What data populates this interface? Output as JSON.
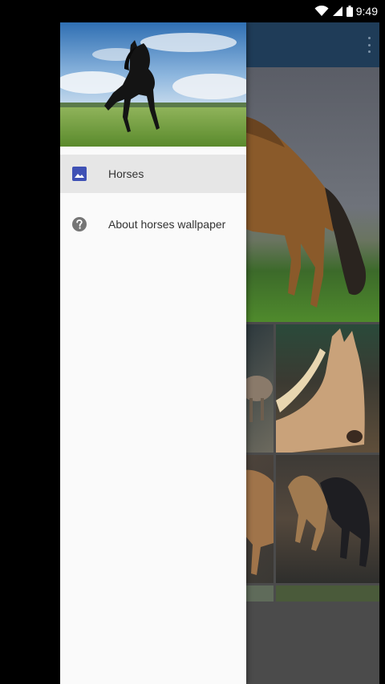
{
  "status_bar": {
    "time": "9:49",
    "icons": [
      "wifi-icon",
      "signal-icon",
      "battery-icon"
    ]
  },
  "app_bar": {
    "overflow_icon": "more-vert-icon"
  },
  "drawer": {
    "header_image": "black-horse-on-grass-image",
    "items": [
      {
        "label": "Horses",
        "icon": "image-icon",
        "selected": true,
        "icon_color": "#3f51b5"
      },
      {
        "label": "About horses wallpaper",
        "icon": "help-icon",
        "selected": false,
        "icon_color": "#757575"
      }
    ]
  },
  "gallery": {
    "images": [
      "bay-horse-wallpaper",
      "horses-wallpaper-2",
      "palomino-horse-wallpaper",
      "horses-wallpaper-4",
      "running-horses-wallpaper",
      "horses-wallpaper-6",
      "horses-wallpaper-7"
    ]
  },
  "colors": {
    "app_bar": "#1f3c58",
    "drawer_bg": "#fafafa",
    "selected_item_bg": "#e6e6e6",
    "accent": "#3f51b5"
  }
}
